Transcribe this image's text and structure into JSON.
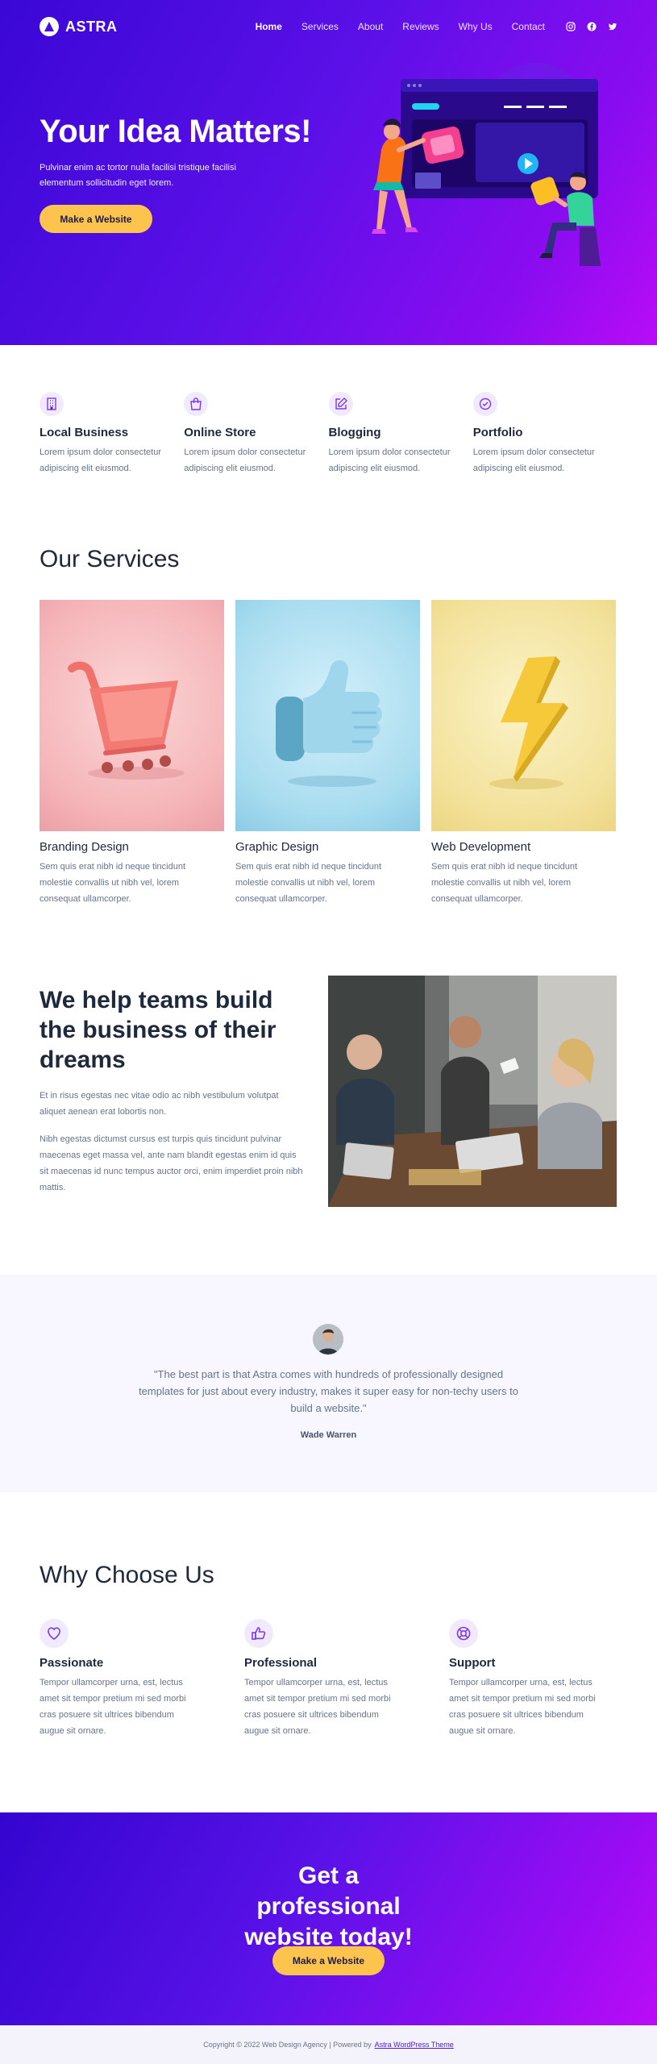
{
  "brand": {
    "name": "ASTRA"
  },
  "nav": {
    "items": [
      {
        "label": "Home"
      },
      {
        "label": "Services"
      },
      {
        "label": "About"
      },
      {
        "label": "Reviews"
      },
      {
        "label": "Why Us"
      },
      {
        "label": "Contact"
      }
    ],
    "social_icons": [
      "instagram-icon",
      "facebook-icon",
      "twitter-icon"
    ]
  },
  "hero": {
    "title": "Your Idea Matters!",
    "text": "Pulvinar enim ac tortor nulla facilisi tristique facilisi elementum sollicitudin eget lorem.",
    "button": "Make a Website"
  },
  "features": [
    {
      "icon": "building-icon",
      "title": "Local Business",
      "text": "Lorem ipsum dolor consectetur adipiscing elit eiusmod."
    },
    {
      "icon": "shopping-bag-icon",
      "title": "Online Store",
      "text": "Lorem ipsum dolor consectetur adipiscing elit eiusmod."
    },
    {
      "icon": "edit-icon",
      "title": "Blogging",
      "text": "Lorem ipsum dolor consectetur adipiscing elit eiusmod."
    },
    {
      "icon": "check-badge-icon",
      "title": "Portfolio",
      "text": "Lorem ipsum dolor consectetur adipiscing elit eiusmod."
    }
  ],
  "services": {
    "title": "Our Services",
    "items": [
      {
        "title": "Branding Design",
        "text": "Sem quis erat nibh id neque tincidunt molestie convallis ut nibh vel, lorem consequat ullamcorper."
      },
      {
        "title": "Graphic Design",
        "text": "Sem quis erat nibh id neque tincidunt molestie convallis ut nibh vel, lorem consequat ullamcorper."
      },
      {
        "title": "Web Development",
        "text": "Sem quis erat nibh id neque tincidunt molestie convallis ut nibh vel, lorem consequat ullamcorper."
      }
    ]
  },
  "teams": {
    "title": "We help teams build the business of their dreams",
    "p1": "Et in risus egestas nec vitae odio ac nibh vestibulum volutpat aliquet aenean erat lobortis non.",
    "p2": "Nibh egestas dictumst cursus est turpis quis tincidunt pulvinar maecenas eget massa vel, ante nam blandit egestas enim id quis sit maecenas id nunc tempus auctor orci, enim imperdiet proin nibh mattis."
  },
  "testimonial": {
    "quote": "\"The best part is that Astra comes with hundreds of professionally designed templates for just about every industry, makes it super easy for non-techy users to build a website.\"",
    "author": "Wade Warren"
  },
  "why": {
    "title": "Why Choose Us",
    "items": [
      {
        "icon": "heart-icon",
        "title": "Passionate",
        "text": "Tempor ullamcorper urna, est, lectus amet sit tempor pretium mi sed morbi cras posuere sit ultrices bibendum augue sit ornare."
      },
      {
        "icon": "thumbs-up-icon",
        "title": "Professional",
        "text": "Tempor ullamcorper urna, est, lectus amet sit tempor pretium mi sed morbi cras posuere sit ultrices bibendum augue sit ornare."
      },
      {
        "icon": "lifebuoy-icon",
        "title": "Support",
        "text": "Tempor ullamcorper urna, est, lectus amet sit tempor pretium mi sed morbi cras posuere sit ultrices bibendum augue sit ornare."
      }
    ]
  },
  "cta": {
    "title": "Get a professional website today!",
    "button": "Make a Website"
  },
  "footer": {
    "copyright": "Copyright © 2022 Web Design Agency | Powered by",
    "link": "Astra WordPress Theme"
  },
  "colors": {
    "accent": "#5b10e8",
    "button": "#fcc44c",
    "icon": "#7c3aed"
  }
}
